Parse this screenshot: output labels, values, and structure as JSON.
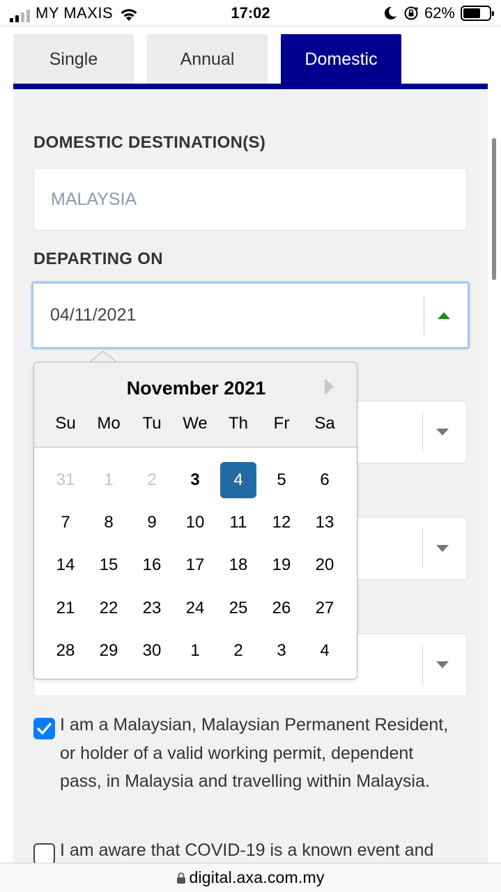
{
  "status_bar": {
    "carrier": "MY MAXIS",
    "time": "17:02",
    "battery_percent": "62%",
    "battery_level": 0.62
  },
  "tabs": [
    {
      "label": "Single",
      "active": false
    },
    {
      "label": "Annual",
      "active": false
    },
    {
      "label": "Domestic",
      "active": true
    }
  ],
  "form": {
    "destination_label": "DOMESTIC DESTINATION(S)",
    "destination_value": "MALAYSIA",
    "departing_label": "DEPARTING ON",
    "departing_value": "04/11/2021"
  },
  "datepicker": {
    "month_title": "November 2021",
    "weekdays": [
      "Su",
      "Mo",
      "Tu",
      "We",
      "Th",
      "Fr",
      "Sa"
    ],
    "selected_day": "4",
    "days": [
      {
        "d": "31",
        "state": "other"
      },
      {
        "d": "1",
        "state": "other"
      },
      {
        "d": "2",
        "state": "other"
      },
      {
        "d": "3",
        "state": "today"
      },
      {
        "d": "4",
        "state": "selected"
      },
      {
        "d": "5",
        "state": ""
      },
      {
        "d": "6",
        "state": ""
      },
      {
        "d": "7",
        "state": ""
      },
      {
        "d": "8",
        "state": ""
      },
      {
        "d": "9",
        "state": ""
      },
      {
        "d": "10",
        "state": ""
      },
      {
        "d": "11",
        "state": ""
      },
      {
        "d": "12",
        "state": ""
      },
      {
        "d": "13",
        "state": ""
      },
      {
        "d": "14",
        "state": ""
      },
      {
        "d": "15",
        "state": ""
      },
      {
        "d": "16",
        "state": ""
      },
      {
        "d": "17",
        "state": ""
      },
      {
        "d": "18",
        "state": ""
      },
      {
        "d": "19",
        "state": ""
      },
      {
        "d": "20",
        "state": ""
      },
      {
        "d": "21",
        "state": ""
      },
      {
        "d": "22",
        "state": ""
      },
      {
        "d": "23",
        "state": ""
      },
      {
        "d": "24",
        "state": ""
      },
      {
        "d": "25",
        "state": ""
      },
      {
        "d": "26",
        "state": ""
      },
      {
        "d": "27",
        "state": ""
      },
      {
        "d": "28",
        "state": ""
      },
      {
        "d": "29",
        "state": ""
      },
      {
        "d": "30",
        "state": ""
      },
      {
        "d": "1",
        "state": "next"
      },
      {
        "d": "2",
        "state": "next"
      },
      {
        "d": "3",
        "state": "next"
      },
      {
        "d": "4",
        "state": "next"
      }
    ]
  },
  "consents": [
    {
      "checked": true,
      "text": "I am a Malaysian, Malaysian Permanent Resident, or holder of a valid working permit, dependent pass, in Malaysia and travelling within Malaysia."
    },
    {
      "checked": false,
      "text": "I am aware that COVID-19 is a known event and"
    }
  ],
  "browser": {
    "url": "digital.axa.com.my"
  },
  "colors": {
    "brand": "#00008f",
    "selected_day": "#216ba5",
    "checkbox": "#0a7cff",
    "caret_up": "#1e8c1e"
  }
}
